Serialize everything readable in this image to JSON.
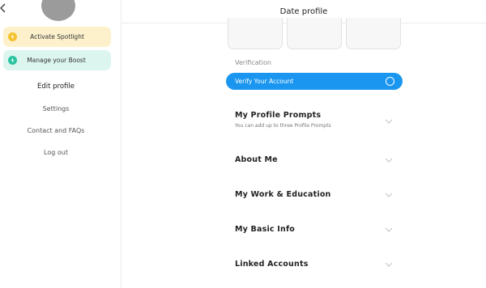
{
  "sidebar": {
    "promos": [
      {
        "label": "Activate Spotlight",
        "icon": "spotlight-icon",
        "color": "#f5c12e",
        "bg": "#fdf1cc"
      },
      {
        "label": "Manage your Boost",
        "icon": "boost-icon",
        "color": "#2cc4a1",
        "bg": "#dcf6ef"
      }
    ],
    "links": [
      {
        "label": "Edit profile",
        "active": true
      },
      {
        "label": "Settings"
      },
      {
        "label": "Contact and FAQs"
      },
      {
        "label": "Log out"
      }
    ]
  },
  "header": {
    "title": "Date profile"
  },
  "main": {
    "verification_label": "Verification",
    "verify_button": "Verify Your Account",
    "sections": [
      {
        "title": "My Profile Prompts",
        "subtitle": "You can add up to three Profile Prompts"
      },
      {
        "title": "About Me"
      },
      {
        "title": "My Work & Education"
      },
      {
        "title": "My Basic Info"
      },
      {
        "title": "Linked Accounts"
      }
    ]
  },
  "colors": {
    "accent": "#1a96f0",
    "spotlight": "#f5c12e",
    "boost": "#2cc4a1"
  }
}
